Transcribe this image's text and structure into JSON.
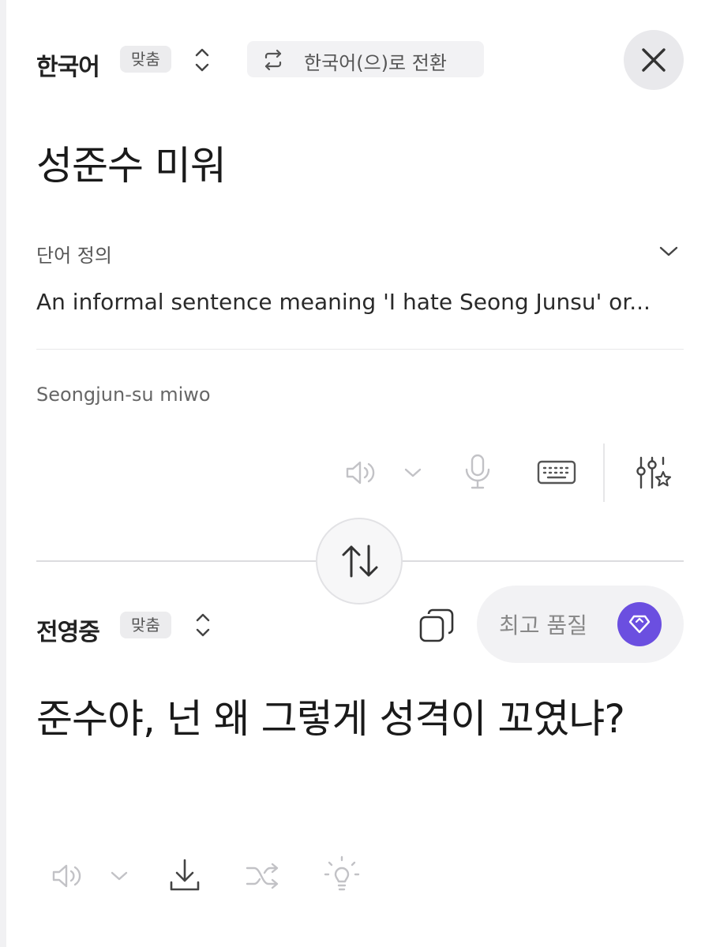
{
  "source": {
    "language": "한국어",
    "mode_badge": "맞춤",
    "switch_label": "한국어(으)로 전환",
    "text": "성준수 미워",
    "definition_title": "단어 정의",
    "definition_body": "An informal sentence meaning 'I hate Seong Junsu' or...",
    "romanization": "Seongjun-su miwo"
  },
  "target": {
    "language": "전영중",
    "mode_badge": "맞춤",
    "quality_label": "최고 품질",
    "text": "준수야, 넌 왜 그렇게 성격이 꼬였냐?"
  },
  "icons": {
    "switch": "swap-arrows-icon",
    "close": "close-icon",
    "speaker": "speaker-icon",
    "mic": "microphone-icon",
    "keyboard": "keyboard-icon",
    "settings": "sliders-star-icon",
    "swap": "swap-vertical-icon",
    "copy": "copy-icon",
    "gem": "gem-icon",
    "download": "download-icon",
    "shuffle": "shuffle-icon",
    "lightbulb": "lightbulb-icon"
  },
  "colors": {
    "accent": "#6b4fe0"
  }
}
